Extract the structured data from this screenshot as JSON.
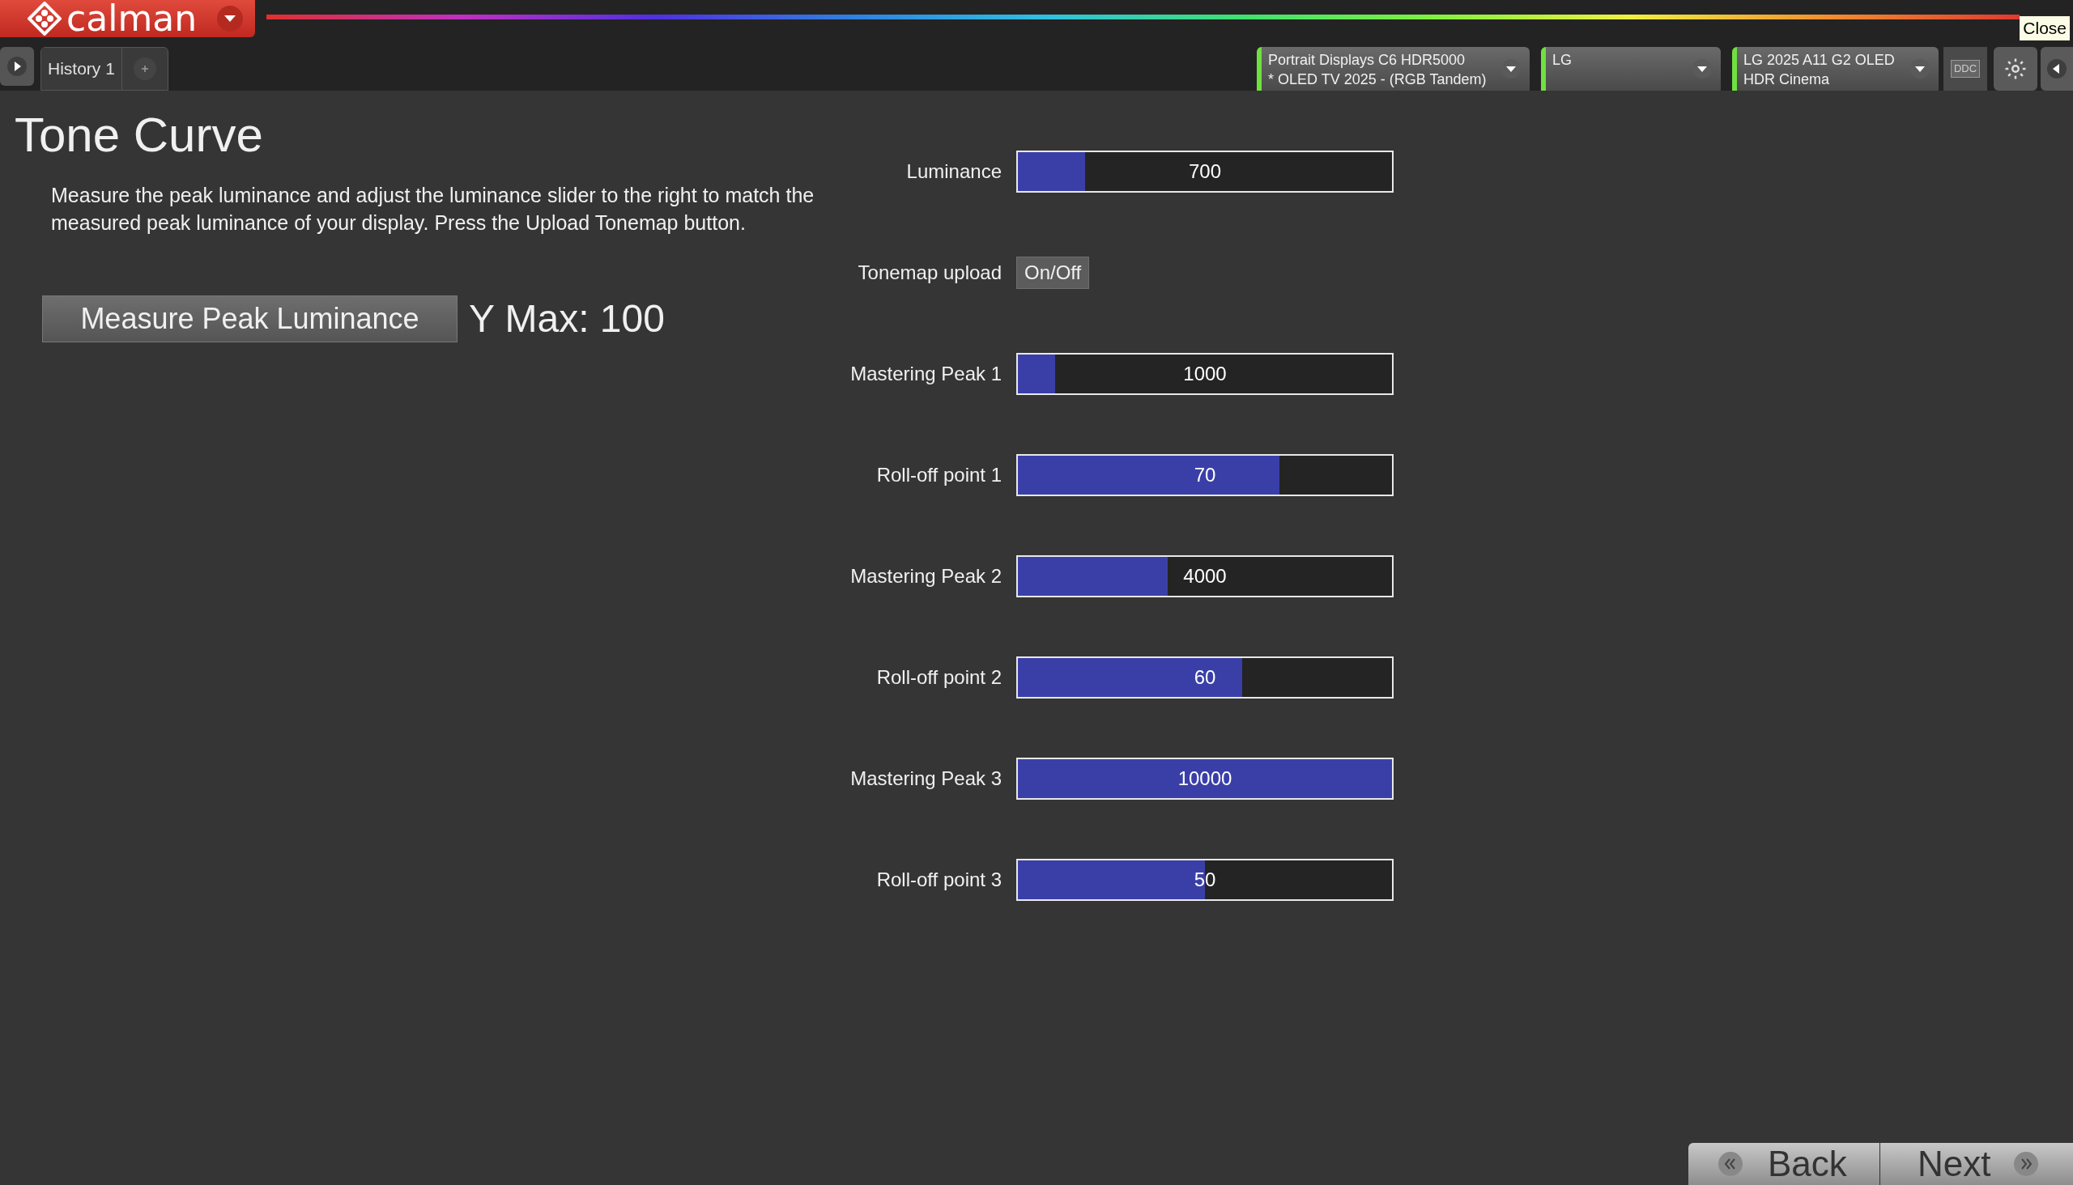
{
  "app": {
    "logo": "calman"
  },
  "tabs": [
    {
      "label": "History 1",
      "selected": true
    }
  ],
  "tooltip": "Close",
  "devices": [
    {
      "line1": "Portrait Displays C6 HDR5000",
      "line2": "* OLED TV 2025 - (RGB Tandem)"
    },
    {
      "line1": "LG"
    },
    {
      "line1": "LG 2025 A11 G2 OLED",
      "line2": "HDR Cinema"
    }
  ],
  "ddc": "DDC",
  "page": {
    "title": "Tone Curve",
    "instructions": "Measure the peak luminance and adjust the luminance slider to the right to match the measured peak luminance of your display. Press the Upload Tonemap button.",
    "measure_button": "Measure Peak Luminance",
    "y_max": "Y Max: 100"
  },
  "controls": [
    {
      "kind": "slider",
      "label": "Luminance",
      "value": "700",
      "level": 0.18
    },
    {
      "kind": "toggle",
      "label": "Tonemap upload",
      "button": "On/Off"
    },
    {
      "kind": "slider",
      "label": "Mastering Peak 1",
      "value": "1000",
      "level": 0.1
    },
    {
      "kind": "slider",
      "label": "Roll-off point 1",
      "value": "70",
      "level": 0.7
    },
    {
      "kind": "slider",
      "label": "Mastering Peak 2",
      "value": "4000",
      "level": 0.4
    },
    {
      "kind": "slider",
      "label": "Roll-off point 2",
      "value": "60",
      "level": 0.6
    },
    {
      "kind": "slider",
      "label": "Mastering Peak 3",
      "value": "10000",
      "level": 1.0
    },
    {
      "kind": "slider",
      "label": "Roll-off point 3",
      "value": "50",
      "level": 0.5
    }
  ],
  "nav": {
    "back": "Back",
    "next": "Next"
  }
}
